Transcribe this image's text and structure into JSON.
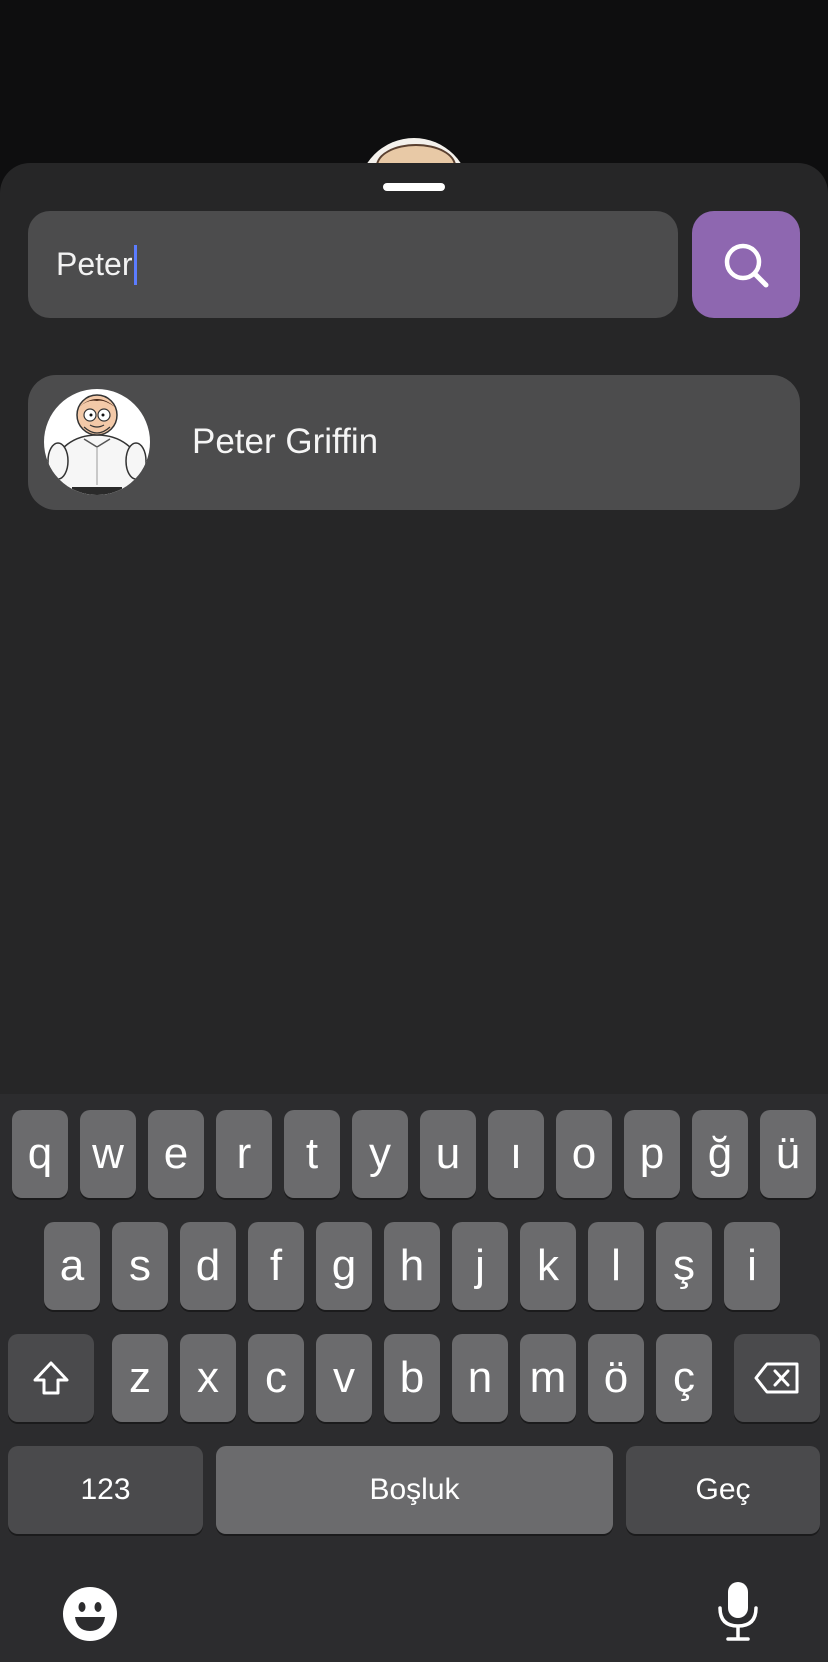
{
  "search": {
    "value": "Peter"
  },
  "results": [
    {
      "name": "Peter Griffin"
    }
  ],
  "keyboard": {
    "row1": [
      "q",
      "w",
      "e",
      "r",
      "t",
      "y",
      "u",
      "ı",
      "o",
      "p",
      "ğ",
      "ü"
    ],
    "row2": [
      "a",
      "s",
      "d",
      "f",
      "g",
      "h",
      "j",
      "k",
      "l",
      "ş",
      "i"
    ],
    "row3": [
      "z",
      "x",
      "c",
      "v",
      "b",
      "n",
      "m",
      "ö",
      "ç"
    ],
    "numbers_label": "123",
    "space_label": "Boşluk",
    "return_label": "Geç"
  },
  "colors": {
    "accent": "#8e67b0",
    "sheet": "#262627",
    "field": "#4c4c4d",
    "caret": "#5b7cff"
  },
  "icons": {
    "search_button": "search-icon",
    "shift": "shift-icon",
    "delete": "backspace-icon",
    "emoji": "emoji-icon",
    "dictation": "microphone-icon"
  }
}
